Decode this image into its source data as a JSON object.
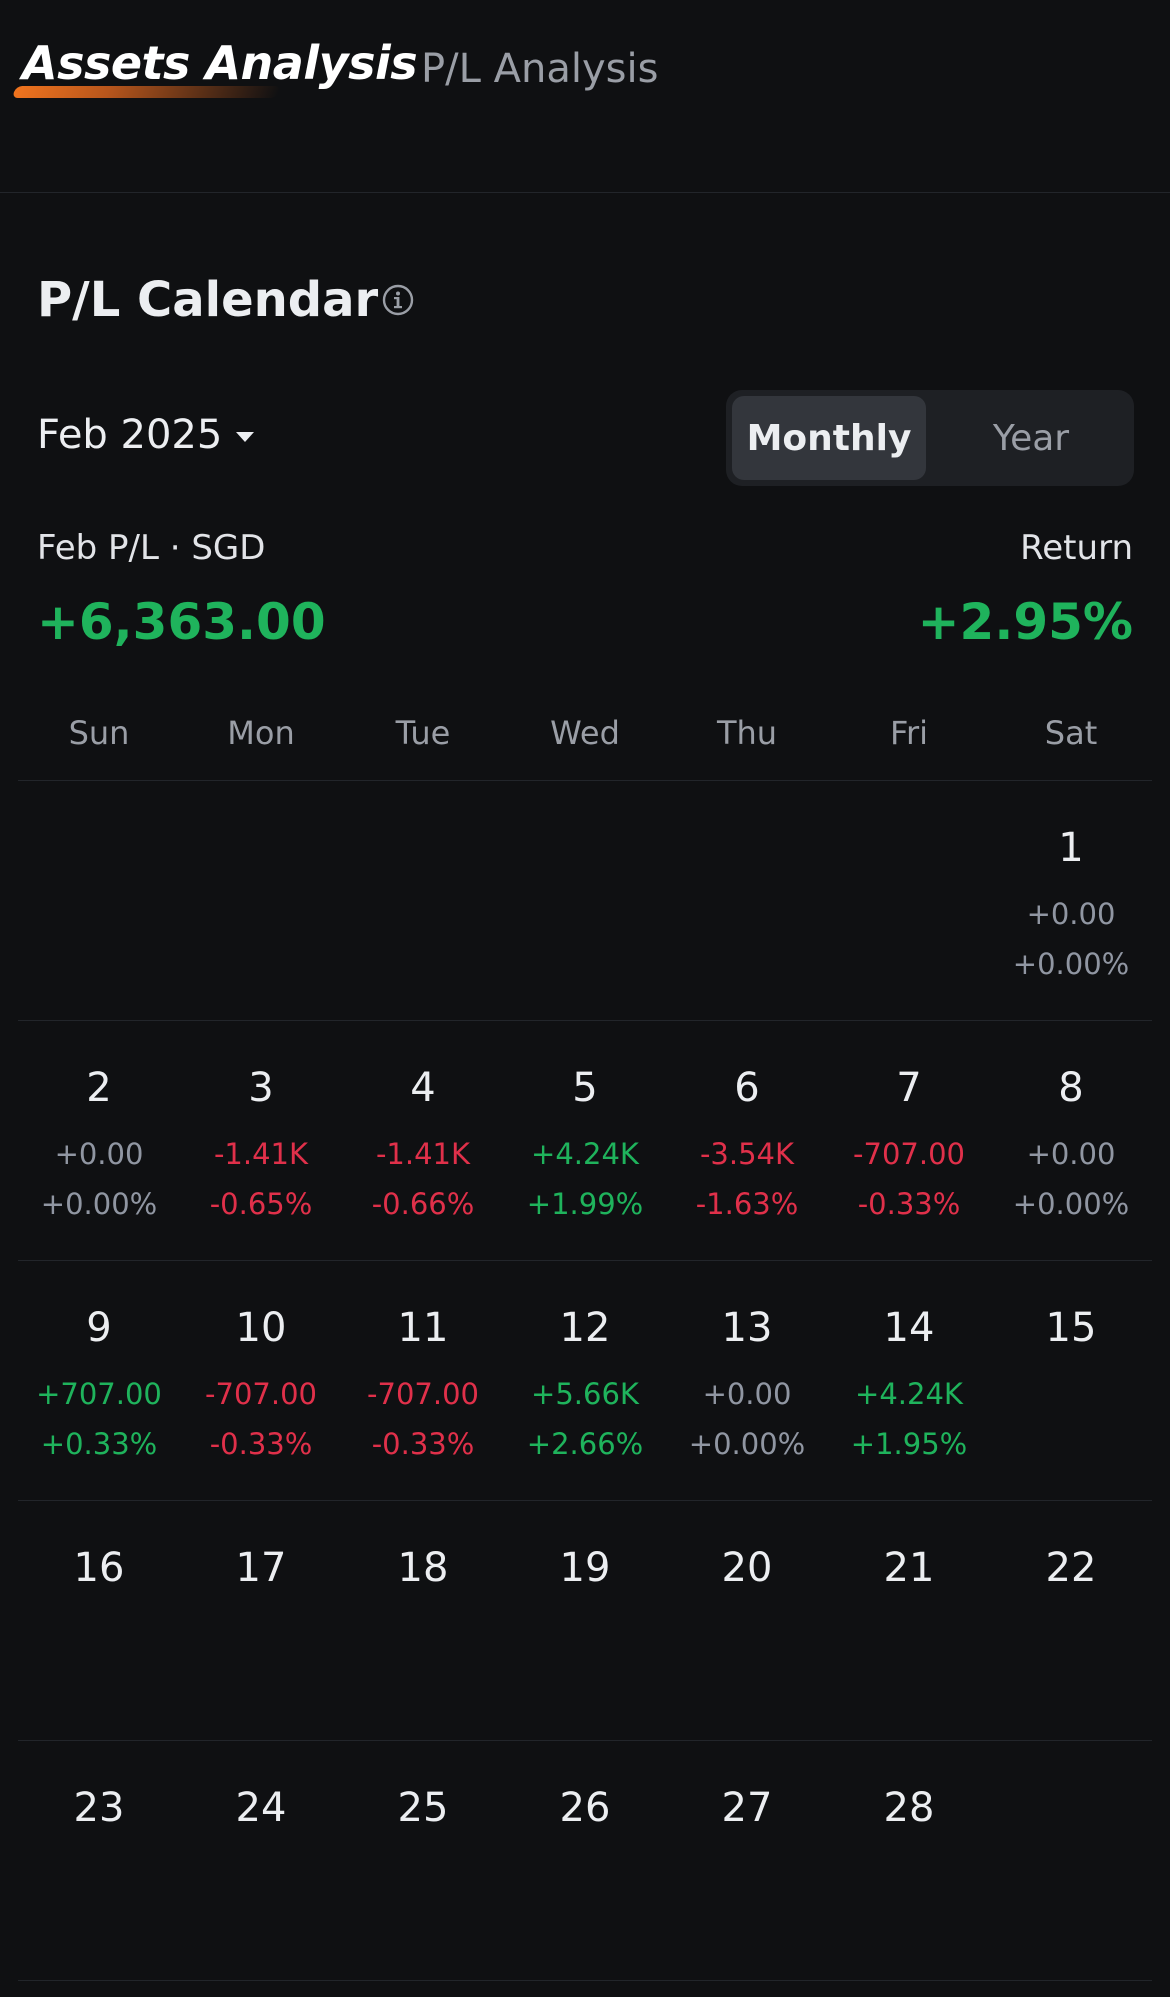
{
  "tabs": {
    "active": "Assets Analysis",
    "inactive": "P/L Analysis"
  },
  "section": {
    "title": "P/L Calendar",
    "info_icon": "info-circle-icon"
  },
  "period": {
    "selected": "Feb 2025",
    "toggle": {
      "monthly": "Monthly",
      "year": "Year",
      "active": "Monthly"
    }
  },
  "summary": {
    "pl_label": "Feb P/L · SGD",
    "pl_value": "+6,363.00",
    "return_label": "Return",
    "return_value": "+2.95%"
  },
  "colors": {
    "positive": "#1fb35c",
    "negative": "#e0304a",
    "neutral": "#9096a2",
    "accent": "#f0741e"
  },
  "calendar": {
    "weekdays": [
      "Sun",
      "Mon",
      "Tue",
      "Wed",
      "Thu",
      "Fri",
      "Sat"
    ],
    "weeks": [
      [
        null,
        null,
        null,
        null,
        null,
        null,
        {
          "day": "1",
          "pl": "+0.00",
          "pct": "+0.00%",
          "trend": "zero"
        }
      ],
      [
        {
          "day": "2",
          "pl": "+0.00",
          "pct": "+0.00%",
          "trend": "zero"
        },
        {
          "day": "3",
          "pl": "-1.41K",
          "pct": "-0.65%",
          "trend": "neg"
        },
        {
          "day": "4",
          "pl": "-1.41K",
          "pct": "-0.66%",
          "trend": "neg"
        },
        {
          "day": "5",
          "pl": "+4.24K",
          "pct": "+1.99%",
          "trend": "pos"
        },
        {
          "day": "6",
          "pl": "-3.54K",
          "pct": "-1.63%",
          "trend": "neg"
        },
        {
          "day": "7",
          "pl": "-707.00",
          "pct": "-0.33%",
          "trend": "neg"
        },
        {
          "day": "8",
          "pl": "+0.00",
          "pct": "+0.00%",
          "trend": "zero"
        }
      ],
      [
        {
          "day": "9",
          "pl": "+707.00",
          "pct": "+0.33%",
          "trend": "pos"
        },
        {
          "day": "10",
          "pl": "-707.00",
          "pct": "-0.33%",
          "trend": "neg"
        },
        {
          "day": "11",
          "pl": "-707.00",
          "pct": "-0.33%",
          "trend": "neg"
        },
        {
          "day": "12",
          "pl": "+5.66K",
          "pct": "+2.66%",
          "trend": "pos"
        },
        {
          "day": "13",
          "pl": "+0.00",
          "pct": "+0.00%",
          "trend": "zero"
        },
        {
          "day": "14",
          "pl": "+4.24K",
          "pct": "+1.95%",
          "trend": "pos"
        },
        {
          "day": "15"
        }
      ],
      [
        {
          "day": "16"
        },
        {
          "day": "17"
        },
        {
          "day": "18"
        },
        {
          "day": "19"
        },
        {
          "day": "20"
        },
        {
          "day": "21"
        },
        {
          "day": "22"
        }
      ],
      [
        {
          "day": "23"
        },
        {
          "day": "24"
        },
        {
          "day": "25"
        },
        {
          "day": "26"
        },
        {
          "day": "27"
        },
        {
          "day": "28"
        },
        null
      ]
    ]
  }
}
